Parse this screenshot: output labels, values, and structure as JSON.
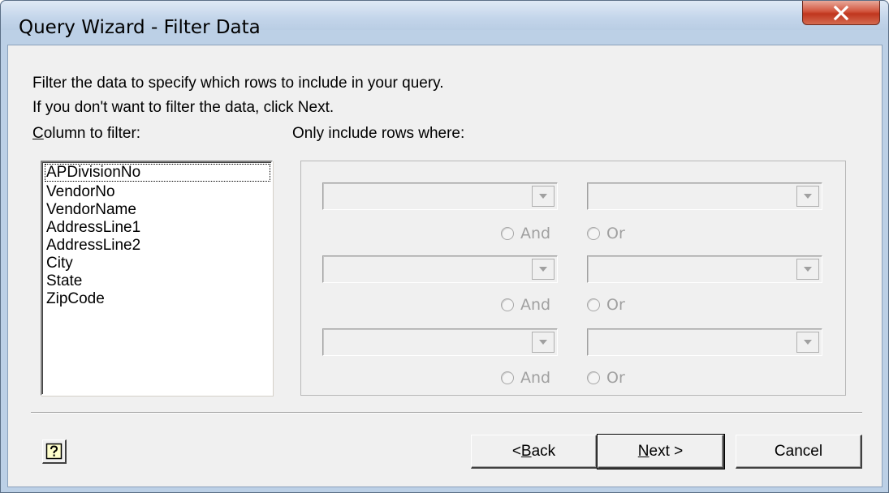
{
  "window": {
    "title": "Query Wizard - Filter Data",
    "close_icon": "close-x-icon"
  },
  "intro": {
    "line1": "Filter the data to specify which rows to include in your query.",
    "line2": "If you don't want to filter the data, click Next."
  },
  "column_label": {
    "mnemonic": "C",
    "rest": "olumn to filter:"
  },
  "only_label": "Only include rows where:",
  "columns": [
    "APDivisionNo",
    "VendorNo",
    "VendorName",
    "AddressLine1",
    "AddressLine2",
    "City",
    "State",
    "ZipCode"
  ],
  "selected_column": "APDivisionNo",
  "filters": [
    {
      "operator": "",
      "value": "",
      "and_label": "And",
      "or_label": "Or"
    },
    {
      "operator": "",
      "value": "",
      "and_label": "And",
      "or_label": "Or"
    },
    {
      "operator": "",
      "value": "",
      "and_label": "And",
      "or_label": "Or"
    }
  ],
  "buttons": {
    "help_icon": "help-question-icon",
    "back": {
      "prefix": "< ",
      "mnemonic": "B",
      "rest": "ack"
    },
    "next": {
      "mnemonic": "N",
      "rest": "ext >"
    },
    "cancel": "Cancel"
  },
  "colors": {
    "titlebar": "#bcd0e6",
    "close_button": "#c8452c",
    "client": "#f0f0f0",
    "disabled_text": "#a0a0a0"
  }
}
